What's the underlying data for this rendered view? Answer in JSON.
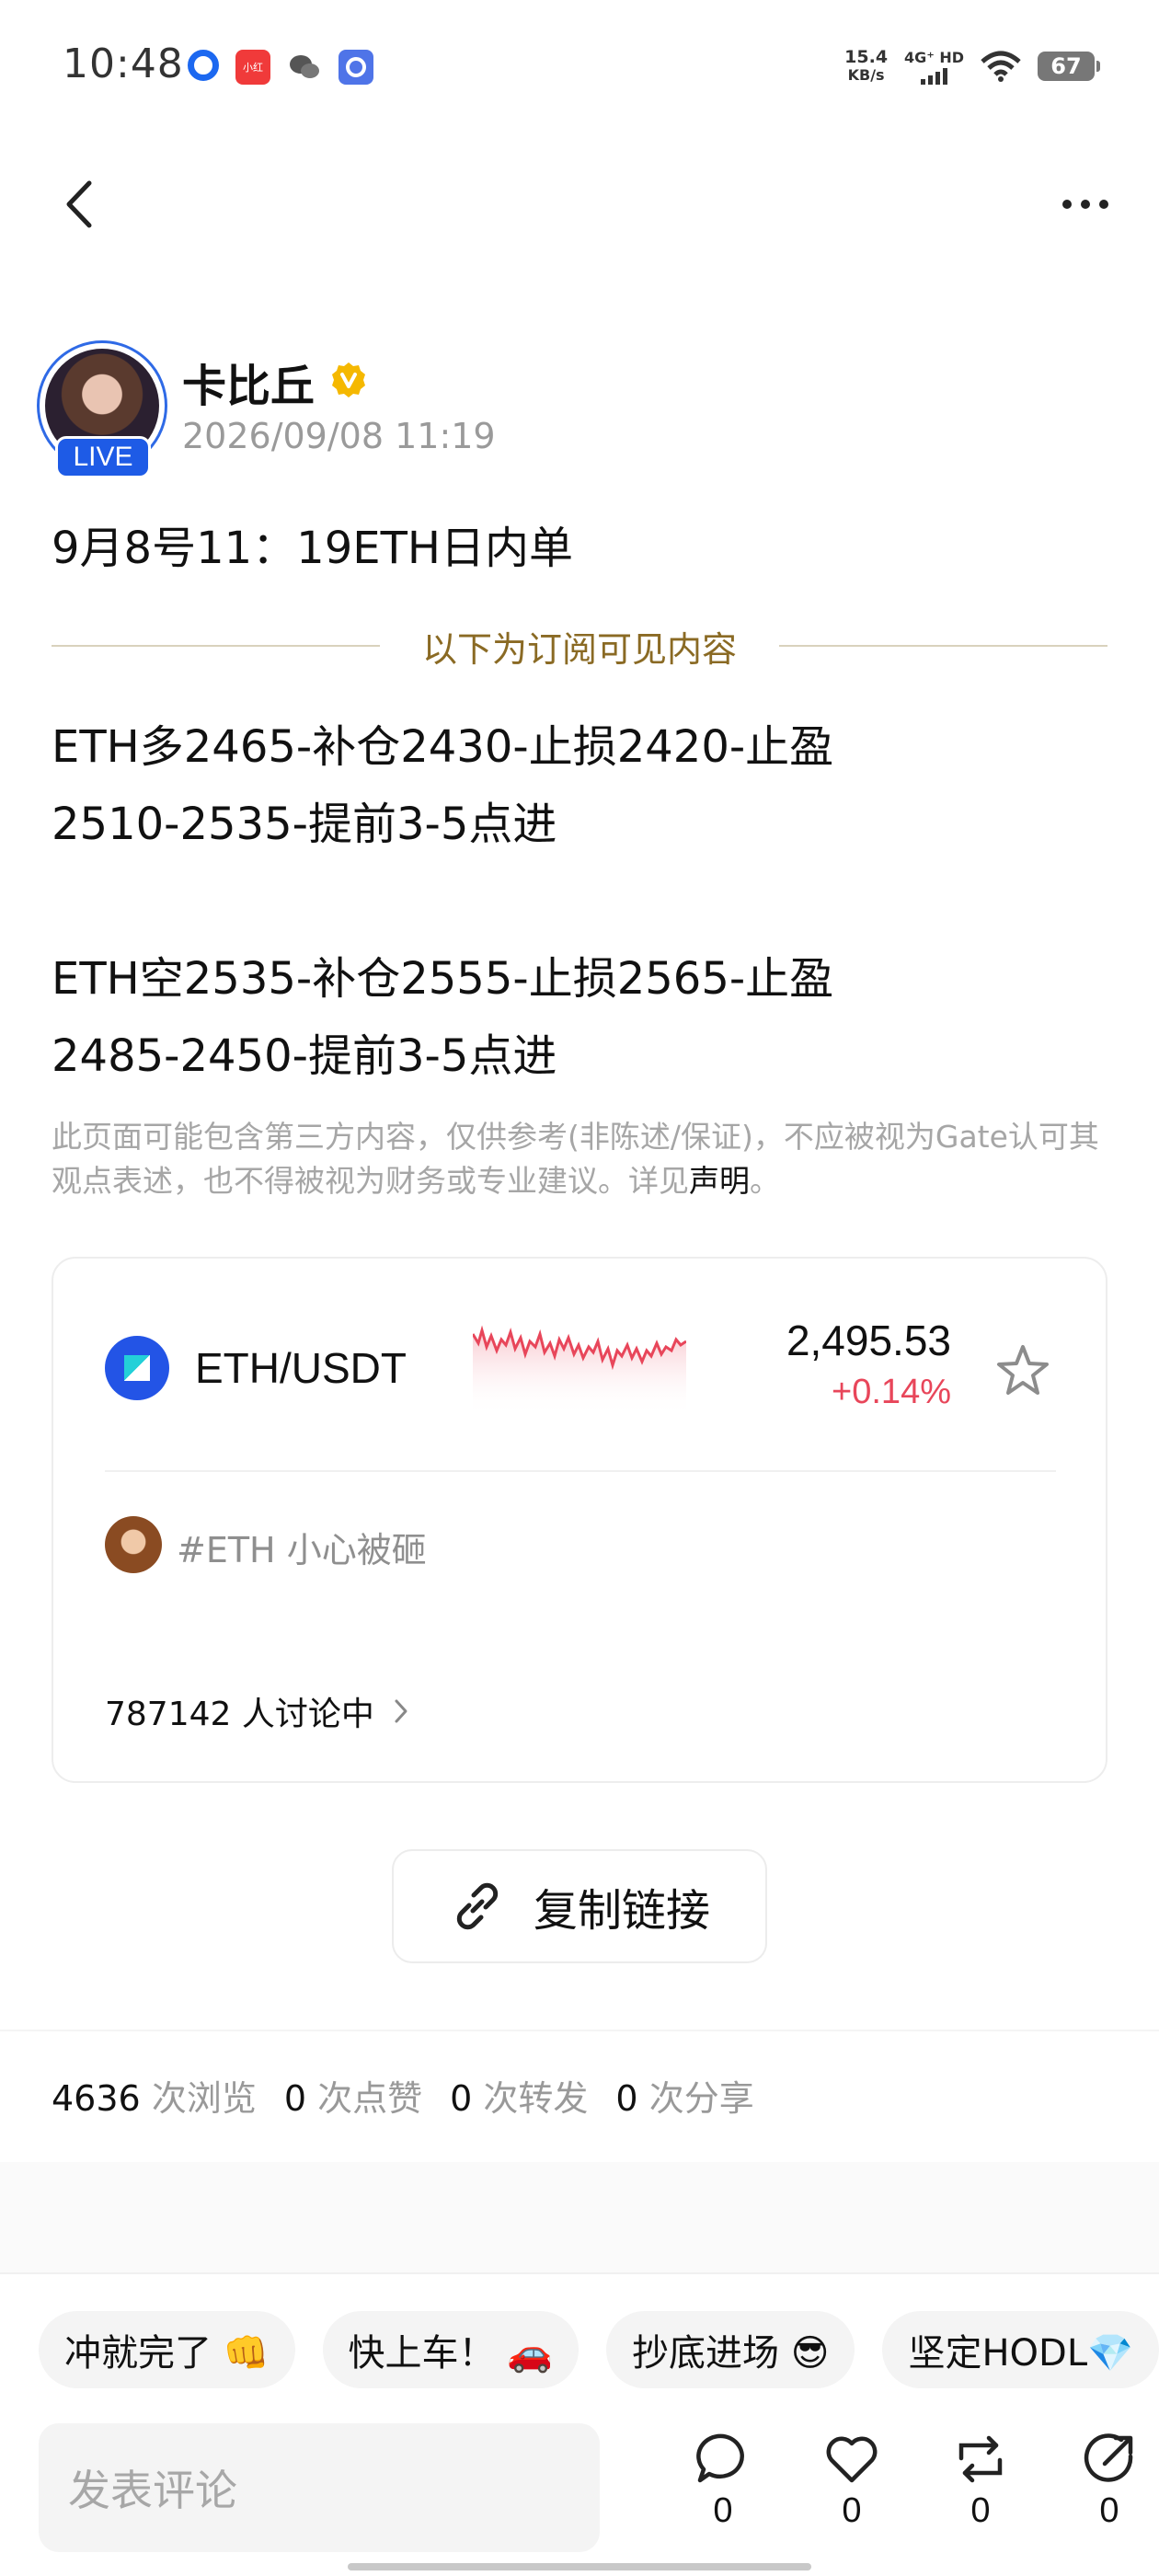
{
  "status_bar": {
    "time": "10:48",
    "speed_value": "15.4",
    "speed_unit": "KB/s",
    "network": "4G⁺ HD",
    "battery": "67"
  },
  "author": {
    "name": "卡比丘",
    "time": "2026/09/08 11:19",
    "live_label": "LIVE"
  },
  "post": {
    "title": "9月8号11：19ETH日内单",
    "subscription_divider": "以下为订阅可见内容",
    "lines": [
      "ETH多2465-补仓2430-止损2420-止盈",
      "2510-2535-提前3-5点进",
      "ETH空2535-补仓2555-止损2565-止盈",
      "2485-2450-提前3-5点进"
    ],
    "disclaimer_text": "此页面可能包含第三方内容，仅供参考(非陈述/保证)，不应被视为Gate认可其观点表述，也不得被视为财务或专业建议。详见",
    "disclaimer_link": "声明",
    "disclaimer_end": "。"
  },
  "market_card": {
    "pair": "ETH/USDT",
    "price": "2,495.53",
    "change": "+0.14%",
    "topic": "#ETH 小心被砸",
    "discussion": "787142 人讨论中"
  },
  "copy_link_label": "复制链接",
  "stats": {
    "views": "4636",
    "views_label": "次浏览",
    "likes": "0",
    "likes_label": "次点赞",
    "reposts": "0",
    "reposts_label": "次转发",
    "shares": "0",
    "shares_label": "次分享"
  },
  "quick_replies": [
    "冲就完了 👊",
    "快上车！ 🚗",
    "抄底进场 😎",
    "坚定HODL💎"
  ],
  "comment_placeholder": "发表评论",
  "actions": {
    "comment_count": "0",
    "like_count": "0",
    "repost_count": "0",
    "share_count": "0"
  },
  "colors": {
    "accent_blue": "#1e5be6",
    "gold": "#8a6a24",
    "down_red": "#e8465a"
  }
}
